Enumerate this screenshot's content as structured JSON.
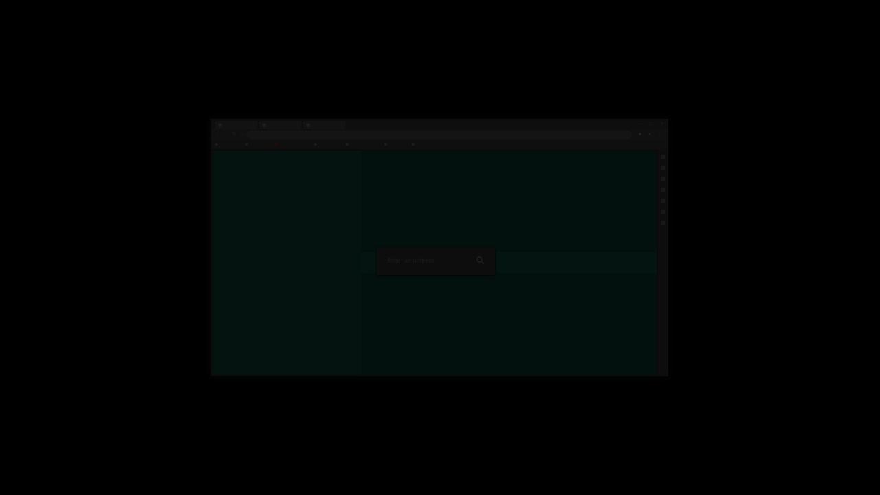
{
  "browser": {
    "tabs": [
      {
        "label": ""
      },
      {
        "label": ""
      },
      {
        "label": ""
      }
    ],
    "address": "",
    "bookmarks": [
      {
        "label": "",
        "accent": "default"
      },
      {
        "label": "",
        "accent": "default"
      },
      {
        "label": "",
        "accent": "red"
      },
      {
        "label": "",
        "accent": "default"
      },
      {
        "label": "",
        "accent": "default"
      },
      {
        "label": "",
        "accent": "default"
      },
      {
        "label": "",
        "accent": "default"
      }
    ]
  },
  "search": {
    "placeholder": "Enter an address"
  },
  "colors": {
    "page_overlay": "#000000",
    "viewport_teal": "#04120f",
    "bookmark_accent_red": "#2a0808"
  },
  "icons": {
    "search": "magnifier-icon",
    "back": "arrow-left-icon",
    "forward": "arrow-right-icon",
    "reload": "reload-icon",
    "home": "home-icon"
  }
}
